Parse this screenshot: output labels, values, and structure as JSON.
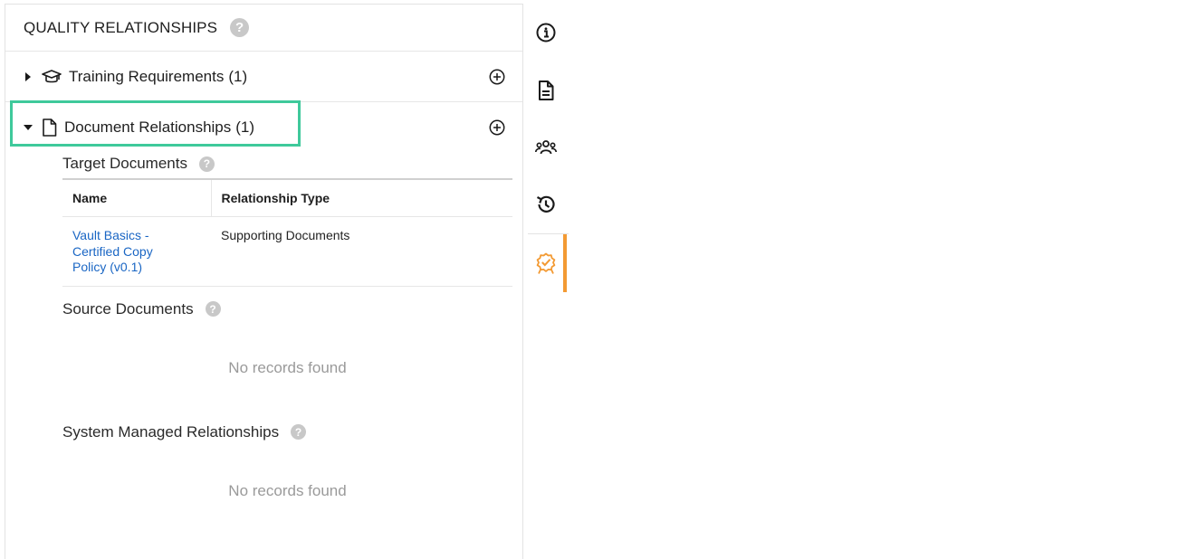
{
  "panel": {
    "title": "QUALITY RELATIONSHIPS",
    "help_glyph": "?"
  },
  "sections": {
    "training": {
      "label": "Training Requirements",
      "count": "(1)",
      "icon": "graduation-cap-icon",
      "expanded": false
    },
    "documents": {
      "label": "Document Relationships",
      "count": "(1)",
      "icon": "document-icon",
      "expanded": true
    }
  },
  "target_documents": {
    "title": "Target Documents",
    "columns": [
      "Name",
      "Relationship Type"
    ],
    "rows": [
      {
        "name": "Vault Basics - Certified Copy Policy (v0.1)",
        "relationship_type": "Supporting Documents"
      }
    ]
  },
  "source_documents": {
    "title": "Source Documents",
    "empty_message": "No records found"
  },
  "system_managed": {
    "title": "System Managed Relationships",
    "empty_message": "No records found"
  },
  "side_rail": {
    "items": [
      "info-icon",
      "document-icon",
      "users-icon",
      "history-icon",
      "quality-badge-icon"
    ],
    "active": "quality-badge-icon",
    "accent_color": "#f39a33"
  },
  "colors": {
    "highlight": "#3fc99b",
    "link": "#1a66c4",
    "muted": "#9a9a9a"
  }
}
